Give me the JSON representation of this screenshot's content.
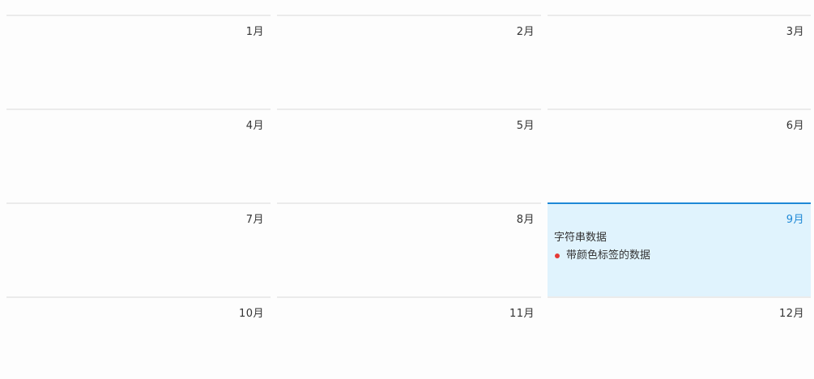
{
  "calendar": {
    "months": [
      {
        "label": "1月"
      },
      {
        "label": "2月"
      },
      {
        "label": "3月"
      },
      {
        "label": "4月"
      },
      {
        "label": "5月"
      },
      {
        "label": "6月"
      },
      {
        "label": "7月"
      },
      {
        "label": "8月"
      },
      {
        "label": "9月",
        "selected": true,
        "events": [
          {
            "text": "字符串数据"
          },
          {
            "text": "带颜色标签的数据",
            "tag_color": "#e53935"
          }
        ]
      },
      {
        "label": "10月"
      },
      {
        "label": "11月"
      },
      {
        "label": "12月"
      }
    ]
  },
  "colors": {
    "accent": "#1e88d6",
    "selected_background": "#e0f3fd",
    "cell_border": "#ebebeb",
    "text": "#333333",
    "tag_red": "#e53935"
  }
}
